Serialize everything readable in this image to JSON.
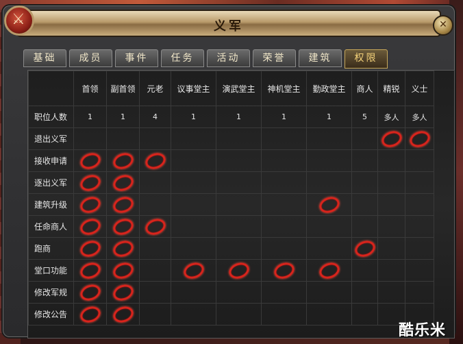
{
  "window": {
    "title": "义军"
  },
  "tabs": [
    {
      "label": "基础",
      "active": false
    },
    {
      "label": "成员",
      "active": false
    },
    {
      "label": "事件",
      "active": false
    },
    {
      "label": "任务",
      "active": false
    },
    {
      "label": "活动",
      "active": false
    },
    {
      "label": "荣誉",
      "active": false
    },
    {
      "label": "建筑",
      "active": false
    },
    {
      "label": "权限",
      "active": true
    }
  ],
  "columns": [
    "首领",
    "副首领",
    "元老",
    "议事堂主",
    "演武堂主",
    "神机堂主",
    "勤政堂主",
    "商人",
    "精锐",
    "义士"
  ],
  "headcount": {
    "label": "职位人数",
    "values": [
      "1",
      "1",
      "4",
      "1",
      "1",
      "1",
      "1",
      "5",
      "多人",
      "多人"
    ]
  },
  "permissions": [
    {
      "label": "退出义军",
      "checks": [
        false,
        false,
        false,
        false,
        false,
        false,
        false,
        false,
        true,
        true
      ]
    },
    {
      "label": "接收申请",
      "checks": [
        true,
        true,
        true,
        false,
        false,
        false,
        false,
        false,
        false,
        false
      ]
    },
    {
      "label": "逐出义军",
      "checks": [
        true,
        true,
        false,
        false,
        false,
        false,
        false,
        false,
        false,
        false
      ]
    },
    {
      "label": "建筑升级",
      "checks": [
        true,
        true,
        false,
        false,
        false,
        false,
        true,
        false,
        false,
        false
      ]
    },
    {
      "label": "任命商人",
      "checks": [
        true,
        true,
        true,
        false,
        false,
        false,
        false,
        false,
        false,
        false
      ]
    },
    {
      "label": "跑商",
      "checks": [
        true,
        true,
        false,
        false,
        false,
        false,
        false,
        true,
        false,
        false
      ]
    },
    {
      "label": "堂口功能",
      "checks": [
        true,
        true,
        false,
        true,
        true,
        true,
        true,
        false,
        false,
        false
      ]
    },
    {
      "label": "修改军规",
      "checks": [
        true,
        true,
        false,
        false,
        false,
        false,
        false,
        false,
        false,
        false
      ]
    },
    {
      "label": "修改公告",
      "checks": [
        true,
        true,
        false,
        false,
        false,
        false,
        false,
        false,
        false,
        false
      ]
    }
  ],
  "icons": {
    "emblem": "crossed-swords-icon",
    "close": "close-icon",
    "check": "red-ring-icon"
  },
  "colors": {
    "ring": "#d8241c",
    "active_tab_text": "#f4d27a",
    "title_bar": "#c8ac7c"
  },
  "watermark": "酷乐米"
}
